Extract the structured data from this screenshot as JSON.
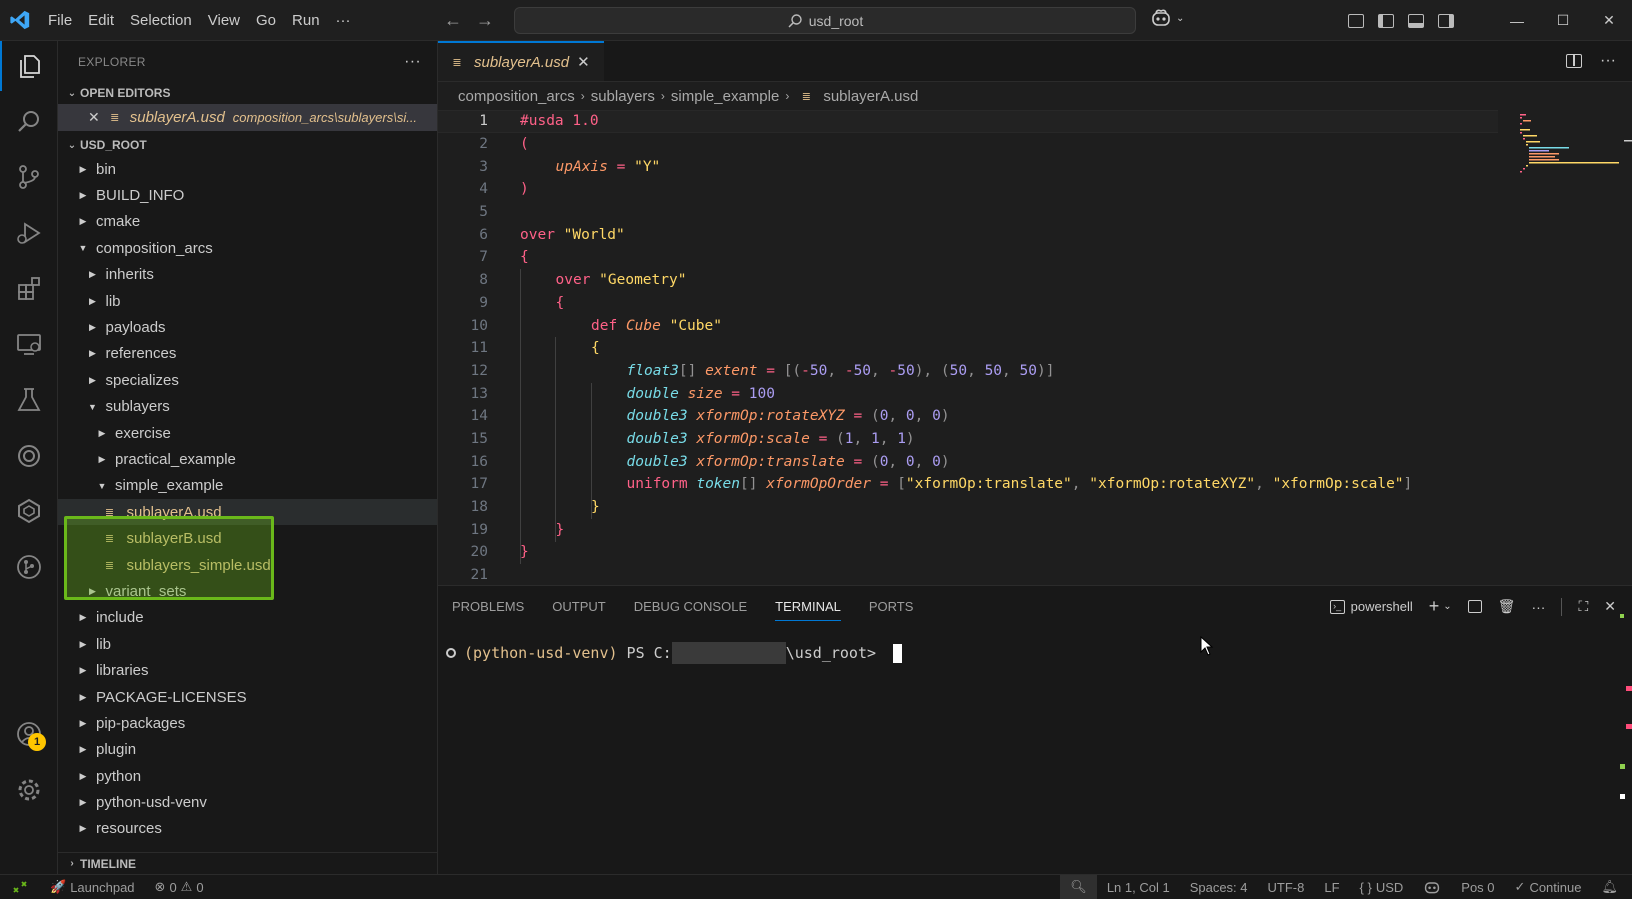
{
  "titlebar": {
    "menu": [
      "File",
      "Edit",
      "Selection",
      "View",
      "Go",
      "Run"
    ],
    "more": "···",
    "search": "usd_root"
  },
  "explorer": {
    "title": "EXPLORER",
    "more": "···",
    "open_editors_title": "OPEN EDITORS",
    "open_editor_name": "sublayerA.usd",
    "open_editor_path": "composition_arcs\\sublayers\\si...",
    "root_title": "USD_ROOT",
    "tree": [
      {
        "label": "bin",
        "depth": 0,
        "type": "folder",
        "state": "closed"
      },
      {
        "label": "BUILD_INFO",
        "depth": 0,
        "type": "folder",
        "state": "closed"
      },
      {
        "label": "cmake",
        "depth": 0,
        "type": "folder",
        "state": "closed"
      },
      {
        "label": "composition_arcs",
        "depth": 0,
        "type": "folder",
        "state": "open"
      },
      {
        "label": "inherits",
        "depth": 1,
        "type": "folder",
        "state": "closed"
      },
      {
        "label": "lib",
        "depth": 1,
        "type": "folder",
        "state": "closed"
      },
      {
        "label": "payloads",
        "depth": 1,
        "type": "folder",
        "state": "closed"
      },
      {
        "label": "references",
        "depth": 1,
        "type": "folder",
        "state": "closed"
      },
      {
        "label": "specializes",
        "depth": 1,
        "type": "folder",
        "state": "closed"
      },
      {
        "label": "sublayers",
        "depth": 1,
        "type": "folder",
        "state": "open"
      },
      {
        "label": "exercise",
        "depth": 2,
        "type": "folder",
        "state": "closed"
      },
      {
        "label": "practical_example",
        "depth": 2,
        "type": "folder",
        "state": "closed"
      },
      {
        "label": "simple_example",
        "depth": 2,
        "type": "folder",
        "state": "open"
      },
      {
        "label": "sublayerA.usd",
        "depth": 3,
        "type": "file",
        "selected": true
      },
      {
        "label": "sublayerB.usd",
        "depth": 3,
        "type": "file"
      },
      {
        "label": "sublayers_simple.usd",
        "depth": 3,
        "type": "file"
      },
      {
        "label": "variant_sets",
        "depth": 1,
        "type": "folder",
        "state": "closed"
      },
      {
        "label": "include",
        "depth": 0,
        "type": "folder",
        "state": "closed"
      },
      {
        "label": "lib",
        "depth": 0,
        "type": "folder",
        "state": "closed"
      },
      {
        "label": "libraries",
        "depth": 0,
        "type": "folder",
        "state": "closed"
      },
      {
        "label": "PACKAGE-LICENSES",
        "depth": 0,
        "type": "folder",
        "state": "closed"
      },
      {
        "label": "pip-packages",
        "depth": 0,
        "type": "folder",
        "state": "closed"
      },
      {
        "label": "plugin",
        "depth": 0,
        "type": "folder",
        "state": "closed"
      },
      {
        "label": "python",
        "depth": 0,
        "type": "folder",
        "state": "closed"
      },
      {
        "label": "python-usd-venv",
        "depth": 0,
        "type": "folder",
        "state": "closed"
      },
      {
        "label": "resources",
        "depth": 0,
        "type": "folder",
        "state": "closed"
      }
    ],
    "timeline_title": "TIMELINE"
  },
  "activity": {
    "account_badge": "1"
  },
  "editor": {
    "tab_label": "sublayerA.usd",
    "tab_close": "✕",
    "breadcrumbs": [
      "composition_arcs",
      "sublayers",
      "simple_example",
      "sublayerA.usd"
    ],
    "lines": [
      {
        "n": "1",
        "indent": 0,
        "parts": [
          [
            "kw",
            "#usda 1.0"
          ]
        ]
      },
      {
        "n": "2",
        "indent": 0,
        "parts": [
          [
            "br",
            "("
          ]
        ]
      },
      {
        "n": "3",
        "indent": 1,
        "parts": [
          [
            "attr",
            "upAxis"
          ],
          [
            "pl",
            " "
          ],
          [
            "kw",
            "="
          ],
          [
            "pl",
            " "
          ],
          [
            "str",
            "\"Y\""
          ]
        ]
      },
      {
        "n": "4",
        "indent": 0,
        "parts": [
          [
            "br",
            ")"
          ]
        ]
      },
      {
        "n": "5",
        "indent": 0,
        "parts": []
      },
      {
        "n": "6",
        "indent": 0,
        "parts": [
          [
            "kw",
            "over"
          ],
          [
            "pl",
            " "
          ],
          [
            "str",
            "\"World\""
          ]
        ]
      },
      {
        "n": "7",
        "indent": 0,
        "parts": [
          [
            "br",
            "{"
          ]
        ]
      },
      {
        "n": "8",
        "indent": 1,
        "parts": [
          [
            "kw",
            "over"
          ],
          [
            "pl",
            " "
          ],
          [
            "str",
            "\"Geometry\""
          ]
        ]
      },
      {
        "n": "9",
        "indent": 1,
        "parts": [
          [
            "br",
            "{"
          ]
        ]
      },
      {
        "n": "10",
        "indent": 2,
        "parts": [
          [
            "kw",
            "def"
          ],
          [
            "pl",
            " "
          ],
          [
            "attr",
            "Cube"
          ],
          [
            "pl",
            " "
          ],
          [
            "str",
            "\"Cube\""
          ]
        ]
      },
      {
        "n": "11",
        "indent": 2,
        "parts": [
          [
            "str",
            "{"
          ]
        ]
      },
      {
        "n": "12",
        "indent": 3,
        "parts": [
          [
            "type",
            "float3"
          ],
          [
            "punc",
            "[]"
          ],
          [
            "pl",
            " "
          ],
          [
            "attr",
            "extent"
          ],
          [
            "pl",
            " "
          ],
          [
            "kw",
            "="
          ],
          [
            "pl",
            " "
          ],
          [
            "punc",
            "[("
          ],
          [
            "kw",
            "-"
          ],
          [
            "num",
            "50"
          ],
          [
            "punc",
            ", "
          ],
          [
            "kw",
            "-"
          ],
          [
            "num",
            "50"
          ],
          [
            "punc",
            ", "
          ],
          [
            "kw",
            "-"
          ],
          [
            "num",
            "50"
          ],
          [
            "punc",
            "), ("
          ],
          [
            "num",
            "50"
          ],
          [
            "punc",
            ", "
          ],
          [
            "num",
            "50"
          ],
          [
            "punc",
            ", "
          ],
          [
            "num",
            "50"
          ],
          [
            "punc",
            ")]"
          ]
        ]
      },
      {
        "n": "13",
        "indent": 3,
        "parts": [
          [
            "type",
            "double"
          ],
          [
            "pl",
            " "
          ],
          [
            "attr",
            "size"
          ],
          [
            "pl",
            " "
          ],
          [
            "kw",
            "="
          ],
          [
            "pl",
            " "
          ],
          [
            "num",
            "100"
          ]
        ]
      },
      {
        "n": "14",
        "indent": 3,
        "parts": [
          [
            "type",
            "double3"
          ],
          [
            "pl",
            " "
          ],
          [
            "attr",
            "xformOp:rotateXYZ"
          ],
          [
            "pl",
            " "
          ],
          [
            "kw",
            "="
          ],
          [
            "pl",
            " "
          ],
          [
            "punc",
            "("
          ],
          [
            "num",
            "0"
          ],
          [
            "punc",
            ", "
          ],
          [
            "num",
            "0"
          ],
          [
            "punc",
            ", "
          ],
          [
            "num",
            "0"
          ],
          [
            "punc",
            ")"
          ]
        ]
      },
      {
        "n": "15",
        "indent": 3,
        "parts": [
          [
            "type",
            "double3"
          ],
          [
            "pl",
            " "
          ],
          [
            "attr",
            "xformOp:scale"
          ],
          [
            "pl",
            " "
          ],
          [
            "kw",
            "="
          ],
          [
            "pl",
            " "
          ],
          [
            "punc",
            "("
          ],
          [
            "num",
            "1"
          ],
          [
            "punc",
            ", "
          ],
          [
            "num",
            "1"
          ],
          [
            "punc",
            ", "
          ],
          [
            "num",
            "1"
          ],
          [
            "punc",
            ")"
          ]
        ]
      },
      {
        "n": "16",
        "indent": 3,
        "parts": [
          [
            "type",
            "double3"
          ],
          [
            "pl",
            " "
          ],
          [
            "attr",
            "xformOp:translate"
          ],
          [
            "pl",
            " "
          ],
          [
            "kw",
            "="
          ],
          [
            "pl",
            " "
          ],
          [
            "punc",
            "("
          ],
          [
            "num",
            "0"
          ],
          [
            "punc",
            ", "
          ],
          [
            "num",
            "0"
          ],
          [
            "punc",
            ", "
          ],
          [
            "num",
            "0"
          ],
          [
            "punc",
            ")"
          ]
        ]
      },
      {
        "n": "17",
        "indent": 3,
        "parts": [
          [
            "kw",
            "uniform"
          ],
          [
            "pl",
            " "
          ],
          [
            "type",
            "token"
          ],
          [
            "punc",
            "[]"
          ],
          [
            "pl",
            " "
          ],
          [
            "attr",
            "xformOpOrder"
          ],
          [
            "pl",
            " "
          ],
          [
            "kw",
            "="
          ],
          [
            "pl",
            " "
          ],
          [
            "punc",
            "["
          ],
          [
            "str",
            "\"xformOp:translate\""
          ],
          [
            "punc",
            ", "
          ],
          [
            "str",
            "\"xformOp:rotateXYZ\""
          ],
          [
            "punc",
            ", "
          ],
          [
            "str",
            "\"xformOp:scale\""
          ],
          [
            "punc",
            "]"
          ]
        ]
      },
      {
        "n": "18",
        "indent": 2,
        "parts": [
          [
            "str",
            "}"
          ]
        ]
      },
      {
        "n": "19",
        "indent": 1,
        "parts": [
          [
            "br",
            "}"
          ]
        ]
      },
      {
        "n": "20",
        "indent": 0,
        "parts": [
          [
            "br",
            "}"
          ]
        ]
      },
      {
        "n": "21",
        "indent": 0,
        "parts": []
      }
    ]
  },
  "panel": {
    "tabs": [
      "PROBLEMS",
      "OUTPUT",
      "DEBUG CONSOLE",
      "TERMINAL",
      "PORTS"
    ],
    "active_tab": "TERMINAL",
    "shell": "powershell",
    "prompt_venv": "(python-usd-venv)",
    "prompt_ps": " PS C:",
    "prompt_tail": "\\usd_root> "
  },
  "statusbar": {
    "launchpad": "Launchpad",
    "errors": "0",
    "warnings": "0",
    "position": "Ln 1, Col 1",
    "spaces": "Spaces: 4",
    "encoding": "UTF-8",
    "eol": "LF",
    "language": "USD",
    "pos": "Pos 0",
    "continue": "Continue"
  },
  "colors": {
    "accent": "#0078d4",
    "highlight_box": "#6ab81a",
    "file_color": "#e2c08d",
    "badge": "#ffc600"
  }
}
